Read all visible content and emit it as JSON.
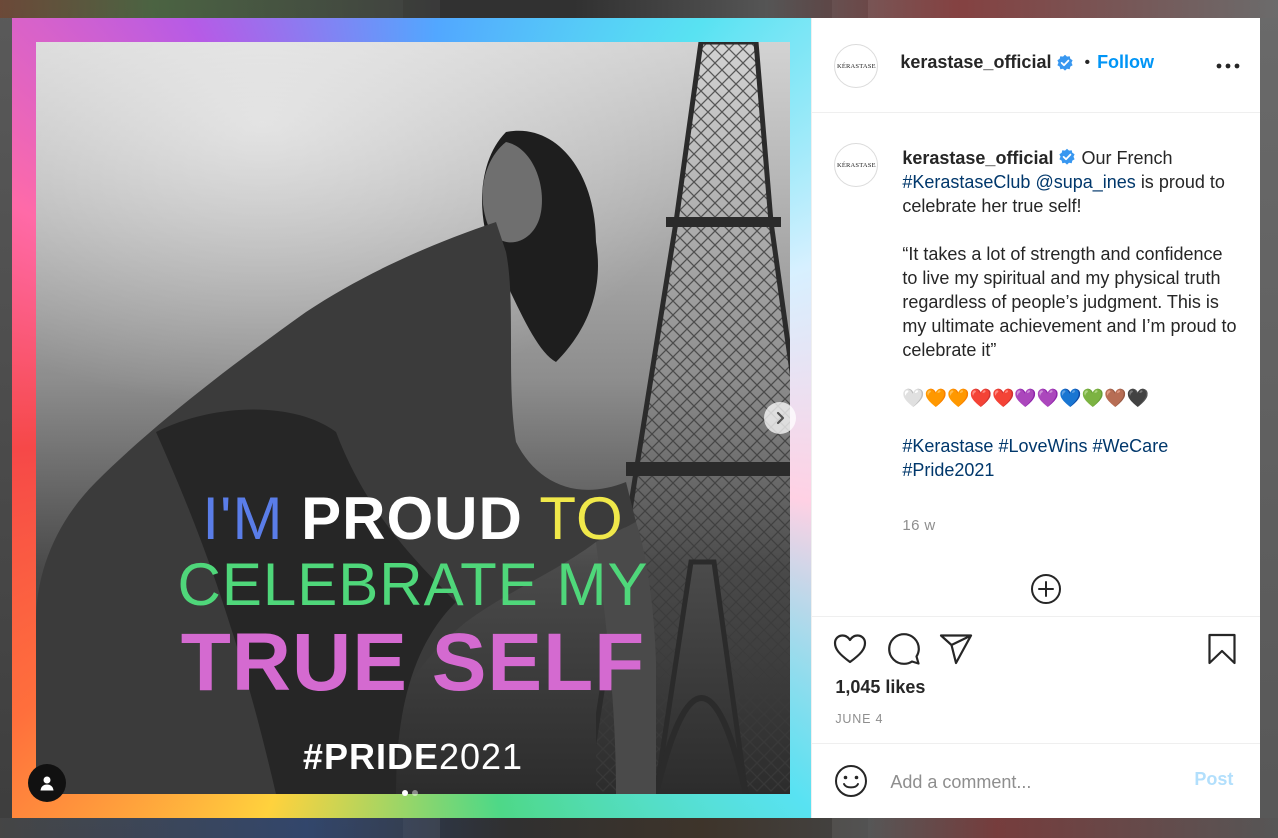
{
  "post": {
    "account": {
      "username": "kerastase_official",
      "avatar_text": "KÉRASTASE",
      "follow_label": "Follow",
      "separator": "•"
    },
    "image_overlay": {
      "word_im": "I'M",
      "word_proud": "PROUD",
      "word_to": "TO",
      "line2": "CELEBRATE MY",
      "line3": "TRUE SELF",
      "hashtag_bold": "#PRIDE",
      "hashtag_year": "2021"
    },
    "caption": {
      "intro": "Our French",
      "hashtag_club": "#KerastaseClub",
      "mention": "@supa_ines",
      "intro_rest": "is proud to celebrate her true self!",
      "quote": "“It takes a lot of strength and confidence to live my spiritual and my physical truth regardless of people’s judgment. This is my ultimate achievement and I’m proud to celebrate it”",
      "hearts": "🤍🧡🧡❤️❤️💜💜💙💚🤎🖤",
      "tags": [
        "#Kerastase",
        "#LoveWins",
        "#WeCare",
        "#Pride2021"
      ]
    },
    "time_ago": "16 w",
    "likes": "1,045 likes",
    "date": "JUNE 4",
    "comment_placeholder": "Add a comment...",
    "post_label": "Post",
    "carousel": {
      "count": 2,
      "active_index": 0
    }
  },
  "colors": {
    "link": "#00376b",
    "follow": "#0095f6",
    "post_disabled": "#b2dffc",
    "overlay_blue": "#5a7de8",
    "overlay_yellow": "#f0e84a",
    "overlay_green": "#4fd77a",
    "overlay_pink": "#d46ad0",
    "verified": "#3897f0"
  }
}
